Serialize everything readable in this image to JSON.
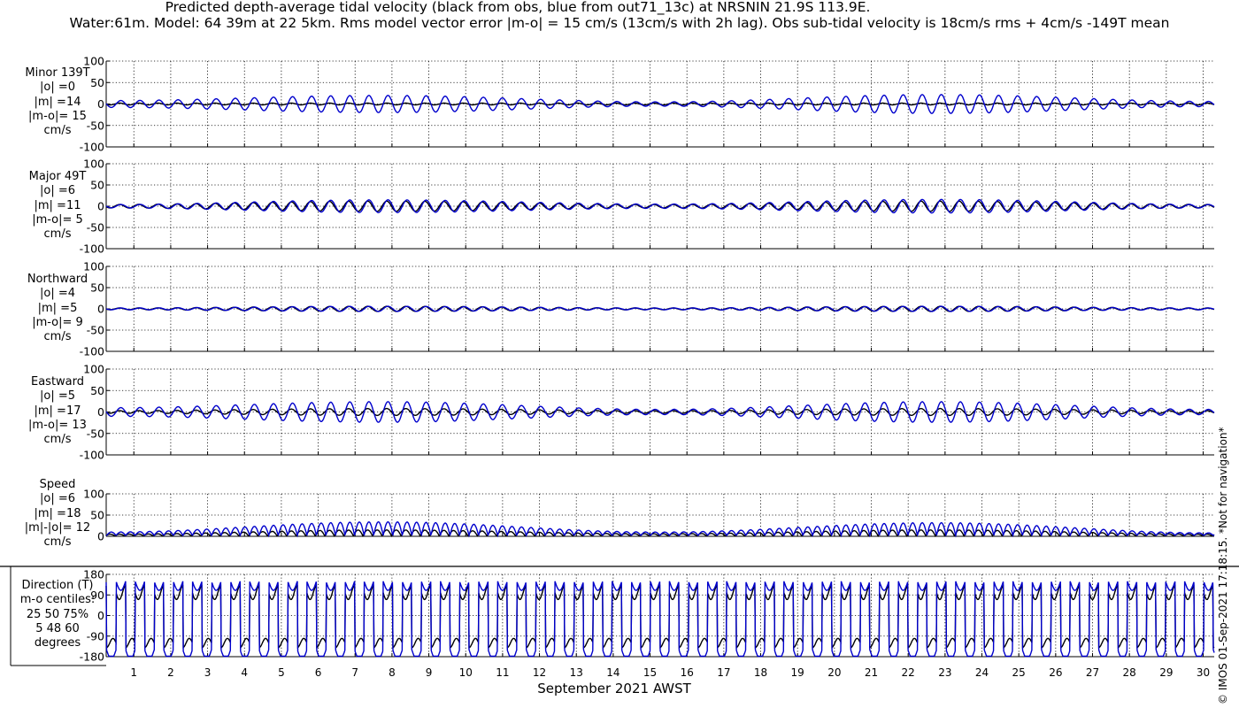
{
  "title": {
    "line1": "Predicted depth-average tidal velocity (black from obs, blue from out71_13c) at NRSNIN 21.9S 113.9E.",
    "line2": "Water:61m. Model: 64 39m at 22 5km. Rms model vector error |m-o| = 15 cm/s (13cm/s with 2h lag). Obs sub-tidal velocity is 18cm/s rms + 4cm/s -149T mean"
  },
  "footer_note": "© IMOS 01-Sep-2021 17:18:15. *Not for navigation*",
  "colors": {
    "obs": "#000000",
    "model": "#0000cc",
    "grid": "#000000",
    "axis": "#000000"
  },
  "chart_data": {
    "type": "line",
    "xlabel": "September 2021 AWST",
    "x_ticks": [
      1,
      2,
      3,
      4,
      5,
      6,
      7,
      8,
      9,
      10,
      11,
      12,
      13,
      14,
      15,
      16,
      17,
      18,
      19,
      20,
      21,
      22,
      23,
      24,
      25,
      26,
      27,
      28,
      29,
      30
    ],
    "xlim": [
      0.25,
      30.3
    ],
    "grid": true,
    "series_legend": [
      "black from obs",
      "blue from out71_13c"
    ],
    "panels": [
      {
        "name": "minor",
        "label_lines": [
          "Minor 139T",
          "|o| =0",
          "|m| =14",
          "|m-o|= 15",
          "cm/s"
        ],
        "ylim": [
          -100,
          100
        ],
        "yticks": [
          100,
          50,
          0,
          -50,
          -100
        ],
        "ytick_labels": [
          "100",
          "50",
          "0",
          "-50",
          "-100"
        ],
        "obs_amplitude": [
          2,
          2,
          2
        ],
        "model_amplitude": [
          8,
          20,
          5,
          22,
          6
        ],
        "kind": "signed"
      },
      {
        "name": "major",
        "label_lines": [
          "Major 49T",
          "|o| =6",
          "|m| =11",
          "|m-o|= 5",
          "cm/s"
        ],
        "ylim": [
          -100,
          100
        ],
        "yticks": [
          100,
          50,
          0,
          -50,
          -100
        ],
        "ytick_labels": [
          "100",
          "50",
          "0",
          "-50",
          "-100"
        ],
        "obs_amplitude": [
          4,
          12,
          4,
          12,
          4
        ],
        "model_amplitude": [
          4,
          15,
          5,
          16,
          4
        ],
        "kind": "signed"
      },
      {
        "name": "northward",
        "label_lines": [
          "Northward",
          "|o| =4",
          "|m| =5",
          "|m-o|= 9",
          "cm/s"
        ],
        "ylim": [
          -100,
          100
        ],
        "yticks": [
          100,
          50,
          0,
          -50,
          -100
        ],
        "ytick_labels": [
          "100",
          "50",
          "0",
          "-50",
          "-100"
        ],
        "obs_amplitude": [
          2,
          6,
          2,
          6,
          2
        ],
        "model_amplitude": [
          2,
          6,
          2,
          6,
          2
        ],
        "kind": "signed"
      },
      {
        "name": "eastward",
        "label_lines": [
          "Eastward",
          "|o| =5",
          "|m| =17",
          "|m-o|= 13",
          "cm/s"
        ],
        "ylim": [
          -100,
          100
        ],
        "yticks": [
          100,
          50,
          0,
          -50,
          -100
        ],
        "ytick_labels": [
          "100",
          "50",
          "0",
          "-50",
          "-100"
        ],
        "obs_amplitude": [
          3,
          8,
          3,
          8,
          3
        ],
        "model_amplitude": [
          10,
          24,
          6,
          24,
          6
        ],
        "kind": "signed"
      },
      {
        "name": "speed",
        "label_lines": [
          "Speed",
          "|o| =6",
          "|m| =18",
          "|m|-|o|= 12",
          "cm/s"
        ],
        "ylim": [
          0,
          100
        ],
        "yticks": [
          100,
          50,
          0
        ],
        "ytick_labels": [
          "100",
          "50",
          "0"
        ],
        "obs_amplitude": [
          4,
          14,
          5,
          14,
          4
        ],
        "model_amplitude": [
          8,
          32,
          8,
          30,
          6
        ],
        "kind": "speed"
      },
      {
        "name": "direction",
        "label_lines": [
          "Direction (T)",
          "m-o centiles:",
          "25  50  75%",
          "5  48  60",
          "degrees"
        ],
        "ylim": [
          -180,
          180
        ],
        "yticks": [
          180,
          90,
          0,
          -90,
          -180
        ],
        "ytick_labels": [
          "180",
          "90",
          "0",
          "-90",
          "-180"
        ],
        "kind": "direction"
      }
    ],
    "tidal_period_days": 0.5175
  }
}
